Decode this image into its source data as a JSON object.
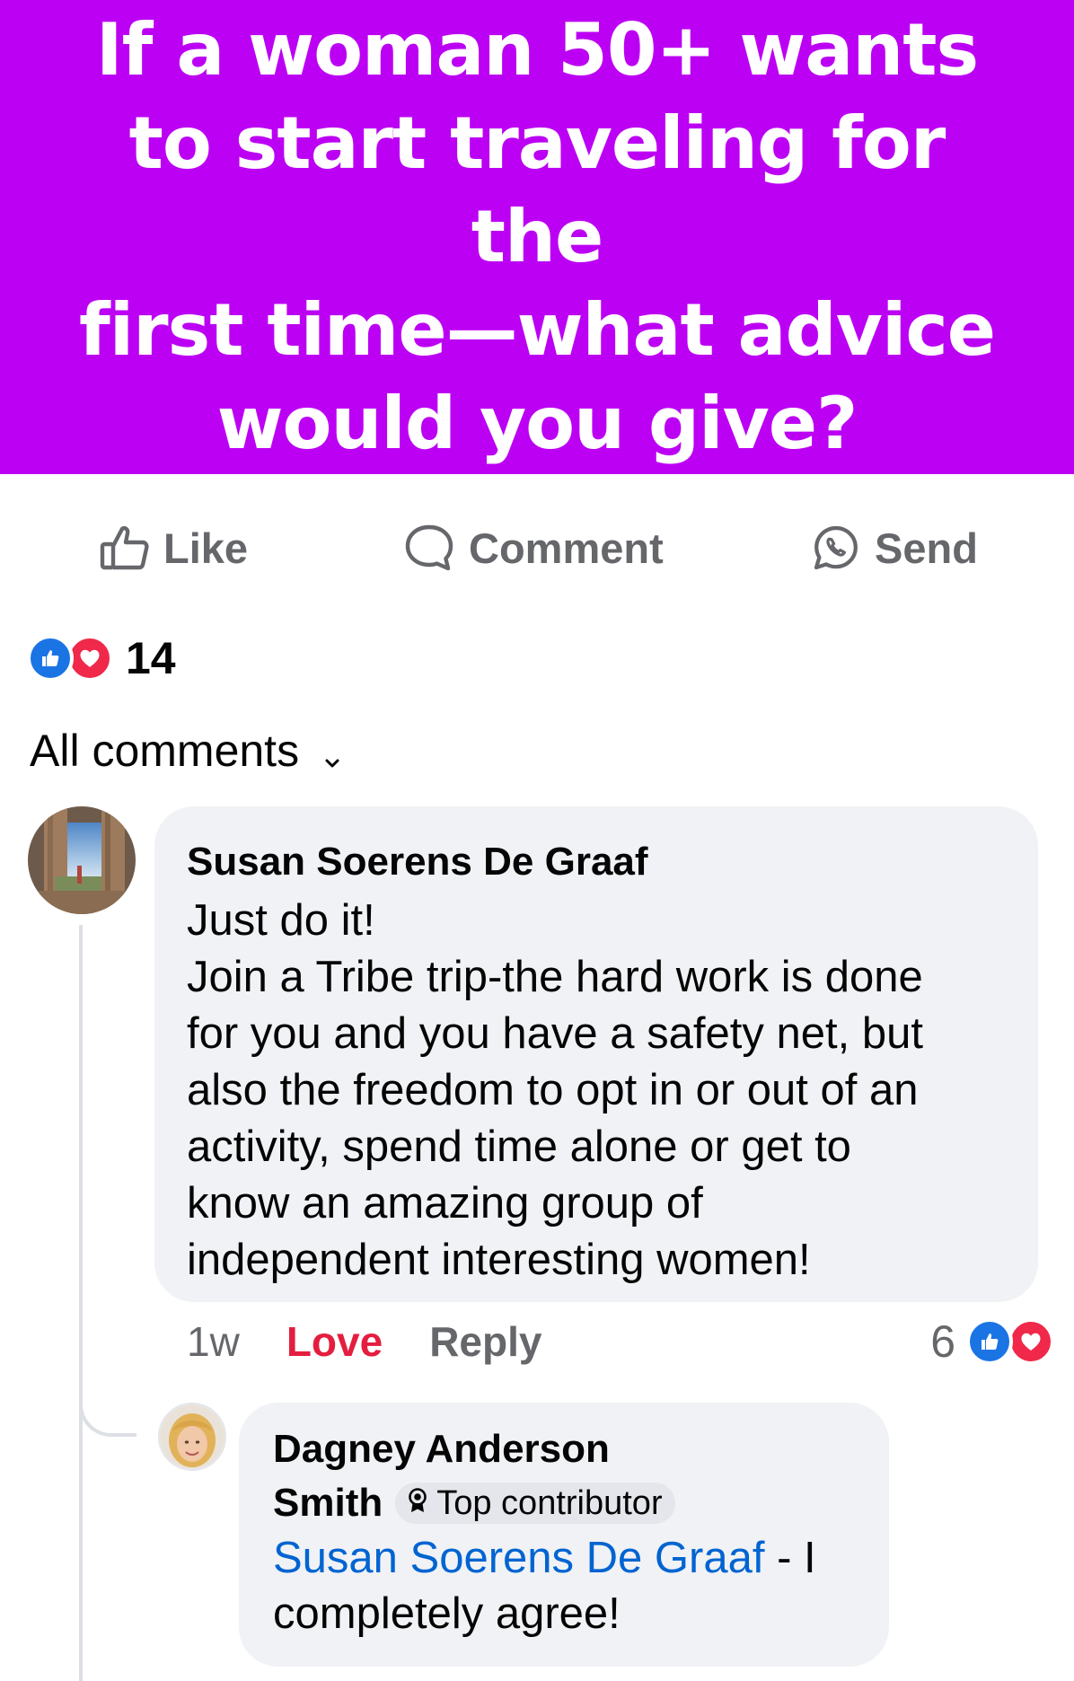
{
  "post": {
    "banner_lines": [
      "If a woman 50+ wants",
      "to start traveling for the",
      "first time—what advice",
      "would you give?"
    ],
    "banner_color": "#bc00f4"
  },
  "actions": {
    "like_label": "Like",
    "comment_label": "Comment",
    "send_label": "Send"
  },
  "reactions": {
    "count": "14",
    "icons": [
      "like-icon",
      "love-icon"
    ]
  },
  "comments_filter": {
    "label": "All comments",
    "icon": "chevron-down-icon"
  },
  "comment": {
    "author": "Susan Soerens De Graaf",
    "text_lines": [
      "Just do it!",
      "Join a Tribe trip-the hard work is done",
      "for you and you have a safety net, but",
      "also the freedom to opt in or out of an",
      "activity, spend time alone or get to",
      "know an amazing group of",
      "independent interesting women!"
    ],
    "time": "1w",
    "love_label": "Love",
    "reply_label": "Reply",
    "reaction_count": "6"
  },
  "reply": {
    "author_line1": "Dagney Anderson",
    "author_line2": "Smith",
    "badge": "Top contributor",
    "mention": "Susan Soerens De Graaf",
    "text_after_mention": " - I",
    "text_line2": "completely agree!"
  },
  "colors": {
    "like_blue": "#1b74e4",
    "love_red": "#f02849",
    "love_text": "#e41e3f",
    "mention_blue": "#0064d1",
    "bubble_bg": "#f0f2f5",
    "muted_text": "#65676b"
  }
}
